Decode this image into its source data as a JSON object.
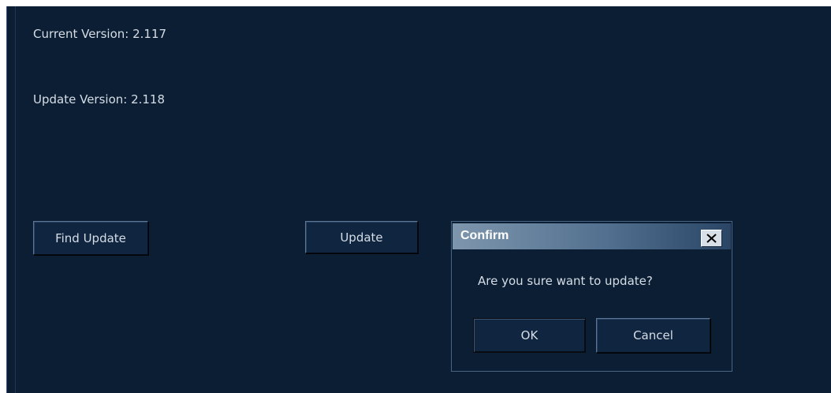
{
  "version_info": {
    "current": "Current Version: 2.117",
    "update": "Update Version: 2.118"
  },
  "buttons": {
    "find_update": "Find Update",
    "update": "Update"
  },
  "dialog": {
    "title": "Confirm",
    "message": "Are you sure want to update?",
    "ok_label": "OK",
    "cancel_label": "Cancel",
    "close_icon": "close-x-icon"
  },
  "colors": {
    "background": "#0b1e33",
    "text": "#d6dde6",
    "titlebar_start": "#7e96ad",
    "titlebar_end": "#2a4565"
  }
}
